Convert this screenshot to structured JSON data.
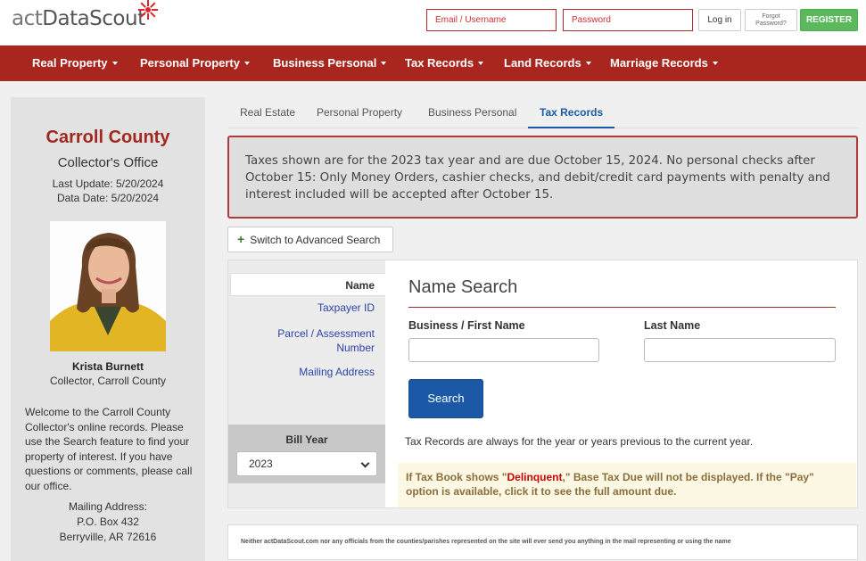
{
  "header": {
    "logo_prefix": "act",
    "logo_brand": "DataScout",
    "email_placeholder": "Email / Username",
    "password_placeholder": "Password",
    "login_label": "Log in",
    "forgot_line1": "Forgot",
    "forgot_line2": "Password?",
    "register_label": "REGISTER"
  },
  "nav": {
    "items": [
      {
        "label": "Real Property"
      },
      {
        "label": "Personal Property"
      },
      {
        "label": "Business Personal"
      },
      {
        "label": "Tax Records"
      },
      {
        "label": "Land Records"
      },
      {
        "label": "Marriage Records"
      }
    ]
  },
  "sidebar": {
    "county": "Carroll County",
    "office": "Collector's Office",
    "last_update": "Last Update: 5/20/2024",
    "data_date": "Data Date: 5/20/2024",
    "collector_name": "Krista Burnett",
    "collector_title": "Collector, Carroll County",
    "welcome": "Welcome to the Carroll County Collector's online records. Please use the Search feature to find your property of interest. If you have questions or comments, please call our office.",
    "mailing_label": "Mailing Address:",
    "po_box": "P.O. Box 432",
    "city": "Berryville, AR 72616"
  },
  "tabs": [
    {
      "label": "Real Estate"
    },
    {
      "label": "Personal Property"
    },
    {
      "label": "Business Personal"
    },
    {
      "label": "Tax Records"
    }
  ],
  "notice": "Taxes shown are for the 2023 tax year and are due October 15, 2024. No personal checks after October 15: Only Money Orders, cashier checks, and debit/credit card payments with penalty and interest included will be accepted after October 15.",
  "advanced_search_label": "Switch to Advanced Search",
  "search_nav": {
    "items": [
      {
        "label": "Name"
      },
      {
        "label": "Taxpayer ID"
      },
      {
        "label": "Parcel / Assessment Number"
      },
      {
        "label": "Mailing Address"
      }
    ],
    "bill_year_label": "Bill Year",
    "bill_year_value": "2023"
  },
  "form": {
    "title": "Name Search",
    "first_name_label": "Business / First Name",
    "last_name_label": "Last Name",
    "search_button": "Search",
    "tax_note": "Tax Records are always for the year or years previous to the current year.",
    "warning_pre": "If Tax Book shows \"",
    "warning_delinquent": "Delinquent",
    "warning_post": ",\" Base Tax Due will not be displayed. If the \"Pay\" option is available, click it to see the full amount due."
  },
  "footer_text": "Neither actDataScout.com nor any officials from the counties/parishes represented on the site will ever send you anything in the mail representing or using the name"
}
